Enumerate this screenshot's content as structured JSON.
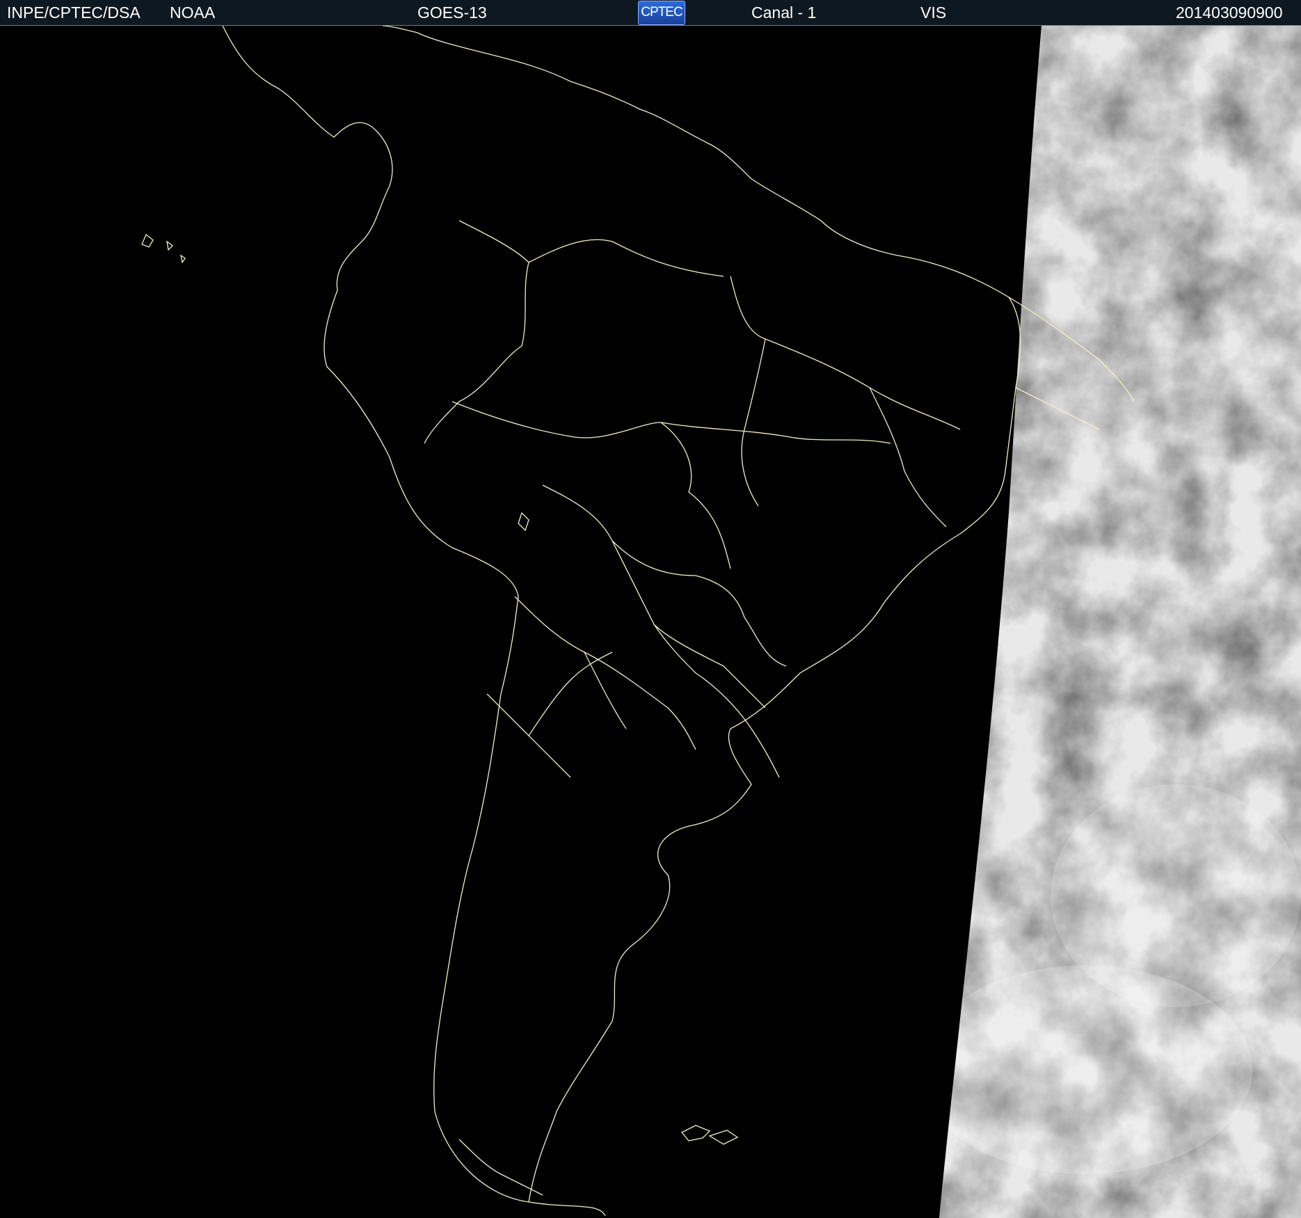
{
  "header": {
    "org": "INPE/CPTEC/DSA",
    "agency": "NOAA",
    "satellite": "GOES-13",
    "logo_text": "CPTEC",
    "channel": "Canal - 1",
    "band": "VIS",
    "timestamp": "201403090900"
  },
  "colors": {
    "background": "#000000",
    "header_bg": "#0e1820",
    "coastline": "#f4f0c0",
    "cloud": "#d8d8d8",
    "ocean_lit": "#6e6e6e"
  },
  "map": {
    "region": "South America",
    "lit_side": "east",
    "icons": [
      "cptec-logo-icon"
    ]
  }
}
